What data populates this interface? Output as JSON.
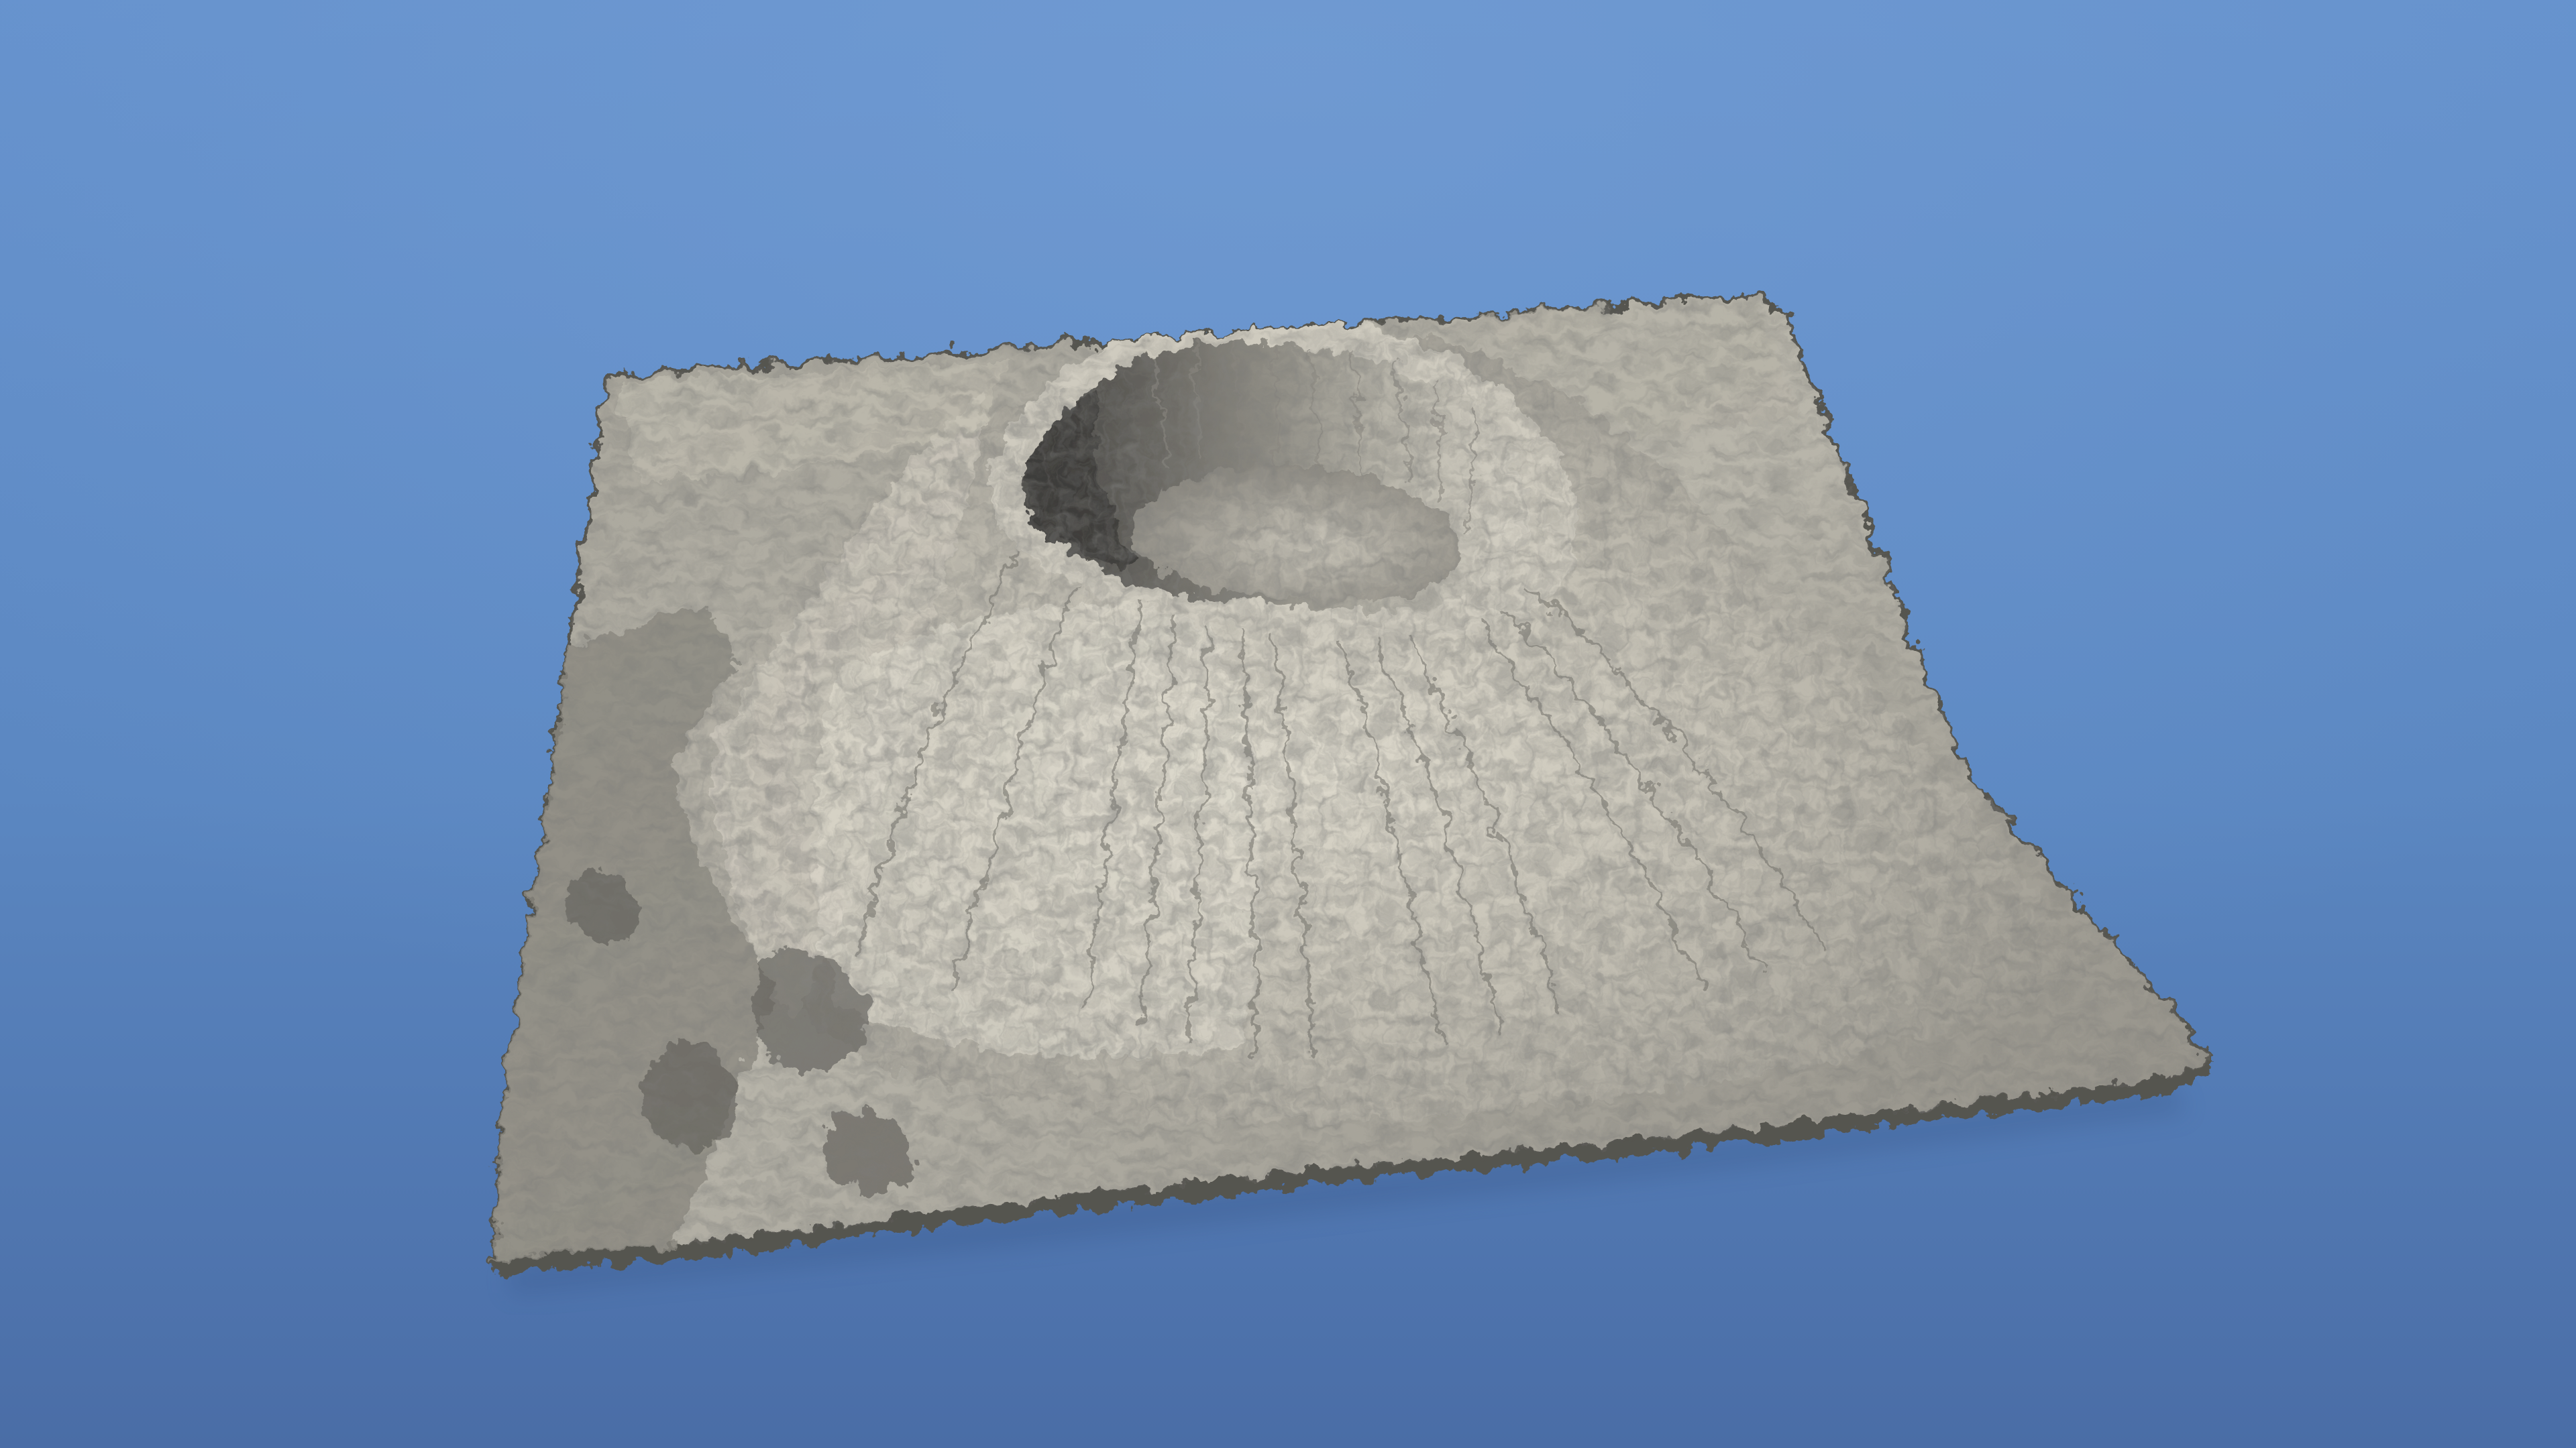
{
  "scene": {
    "subject": "terrain-heightmap-render",
    "colors": {
      "sky_top": "#6390cc",
      "sky_mid": "#5b87c1",
      "sky_bottom": "#4a6da6",
      "terrain_light": "#d9d5c9",
      "terrain_mid": "#a9a69c",
      "terrain_dark": "#6f6d67",
      "terrain_shadow": "#3d3c3a",
      "terrain_edge": "#55544f"
    }
  }
}
